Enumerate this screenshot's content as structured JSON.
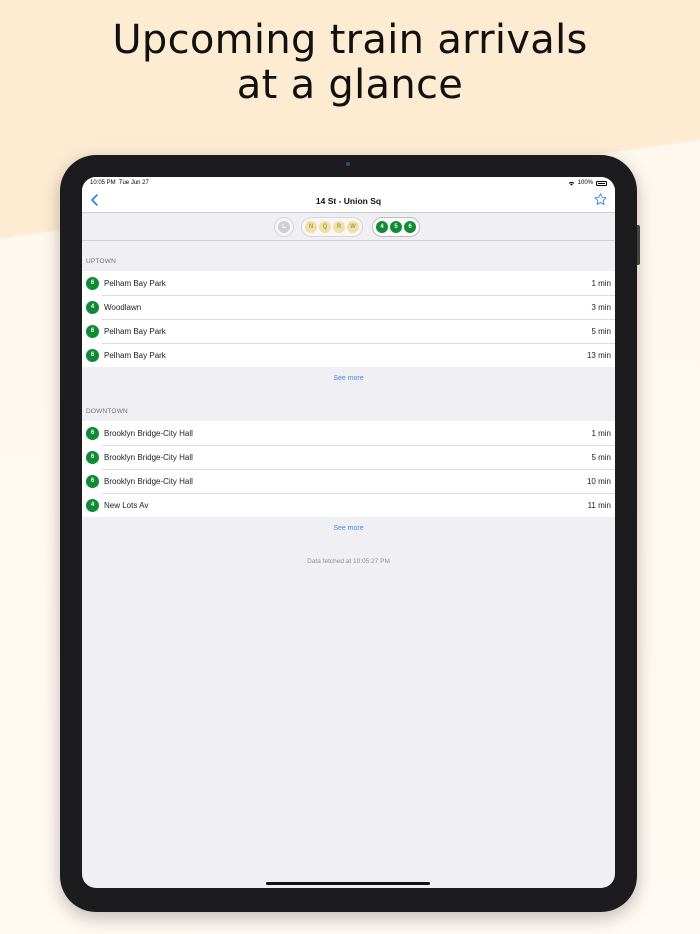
{
  "headline": {
    "line1": "Upcoming train arrivals",
    "line2": "at a glance"
  },
  "status_bar": {
    "time": "10:05 PM",
    "date": "Tue Jun 27",
    "battery": "100%"
  },
  "nav": {
    "title": "14 St - Union Sq",
    "back_icon": "chevron-left-icon",
    "favorite_icon": "star-outline-icon"
  },
  "line_groups": [
    {
      "lines": [
        "L"
      ],
      "color": "#cfcfd3",
      "active": false
    },
    {
      "lines": [
        "N",
        "Q",
        "R",
        "W"
      ],
      "color": "#f1e1a0",
      "active": false
    },
    {
      "lines": [
        "4",
        "5",
        "6"
      ],
      "color": "#0f8a35",
      "active": true
    }
  ],
  "uptown": {
    "label": "UPTOWN",
    "arrivals": [
      {
        "route": "6",
        "destination": "Pelham Bay Park",
        "eta": "1 min"
      },
      {
        "route": "4",
        "destination": "Woodlawn",
        "eta": "3 min"
      },
      {
        "route": "6",
        "destination": "Pelham Bay Park",
        "eta": "5 min"
      },
      {
        "route": "6",
        "destination": "Pelham Bay Park",
        "eta": "13 min"
      }
    ],
    "see_more": "See more"
  },
  "downtown": {
    "label": "DOWNTOWN",
    "arrivals": [
      {
        "route": "6",
        "destination": "Brooklyn Bridge-City Hall",
        "eta": "1 min"
      },
      {
        "route": "6",
        "destination": "Brooklyn Bridge-City Hall",
        "eta": "5 min"
      },
      {
        "route": "6",
        "destination": "Brooklyn Bridge-City Hall",
        "eta": "10 min"
      },
      {
        "route": "4",
        "destination": "New Lots Av",
        "eta": "11 min"
      }
    ],
    "see_more": "See more"
  },
  "footer": {
    "fetched": "Data fetched at 10:05:27 PM"
  },
  "colors": {
    "accent": "#3d8fe6",
    "route_green": "#0f8a35",
    "background": "#fdecd2"
  }
}
